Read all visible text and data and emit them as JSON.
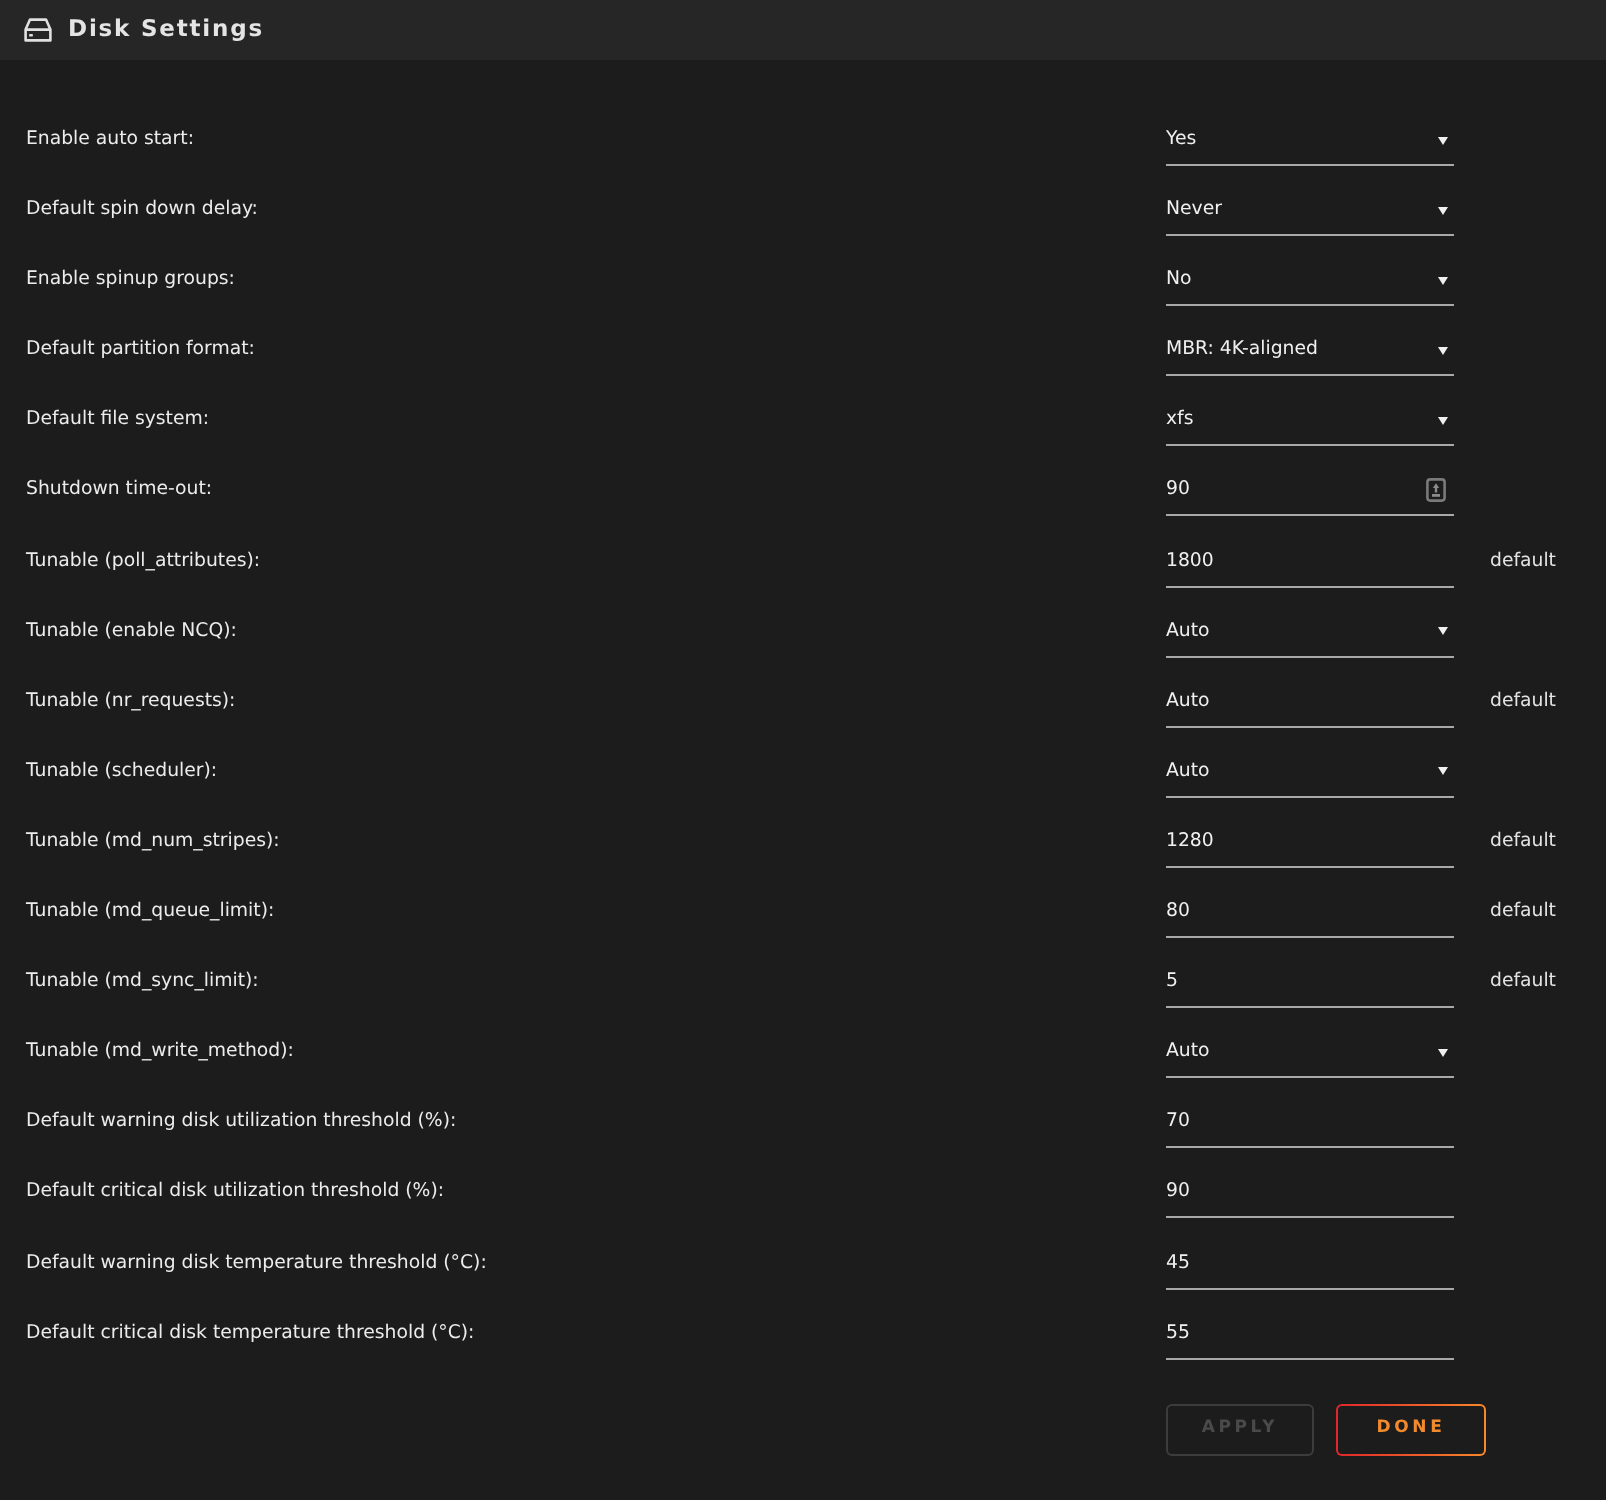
{
  "header": {
    "title": "Disk Settings"
  },
  "settings": [
    {
      "label": "Enable auto start:",
      "control": {
        "kind": "select",
        "value": "Yes"
      }
    },
    {
      "label": "Default spin down delay:",
      "control": {
        "kind": "select",
        "value": "Never"
      }
    },
    {
      "label": "Enable spinup groups:",
      "control": {
        "kind": "select",
        "value": "No"
      }
    },
    {
      "label": "Default partition format:",
      "control": {
        "kind": "select",
        "value": "MBR: 4K-aligned"
      }
    },
    {
      "label": "Default file system:",
      "control": {
        "kind": "select",
        "value": "xfs"
      }
    },
    {
      "label": "Shutdown time-out:",
      "control": {
        "kind": "number",
        "value": "90"
      }
    },
    {
      "label": "Tunable (poll_attributes):",
      "control": {
        "kind": "text",
        "value": "1800"
      },
      "note": "default"
    },
    {
      "label": "Tunable (enable NCQ):",
      "control": {
        "kind": "select",
        "value": "Auto"
      }
    },
    {
      "label": "Tunable (nr_requests):",
      "control": {
        "kind": "text",
        "value": "Auto"
      },
      "note": "default"
    },
    {
      "label": "Tunable (scheduler):",
      "control": {
        "kind": "select",
        "value": "Auto"
      }
    },
    {
      "label": "Tunable (md_num_stripes):",
      "control": {
        "kind": "text",
        "value": "1280"
      },
      "note": "default"
    },
    {
      "label": "Tunable (md_queue_limit):",
      "control": {
        "kind": "text",
        "value": "80"
      },
      "note": "default"
    },
    {
      "label": "Tunable (md_sync_limit):",
      "control": {
        "kind": "text",
        "value": "5"
      },
      "note": "default"
    },
    {
      "label": "Tunable (md_write_method):",
      "control": {
        "kind": "select",
        "value": "Auto"
      }
    },
    {
      "label": "Default warning disk utilization threshold (%):",
      "control": {
        "kind": "text",
        "value": "70"
      }
    },
    {
      "label": "Default critical disk utilization threshold (%):",
      "control": {
        "kind": "text",
        "value": "90"
      }
    },
    {
      "label": "Default warning disk temperature threshold (°C):",
      "control": {
        "kind": "text",
        "value": "45"
      }
    },
    {
      "label": "Default critical disk temperature threshold (°C):",
      "control": {
        "kind": "text",
        "value": "55"
      }
    }
  ],
  "buttons": [
    {
      "label": "APPLY",
      "disabled": true
    },
    {
      "label": "DONE",
      "disabled": false
    }
  ]
}
